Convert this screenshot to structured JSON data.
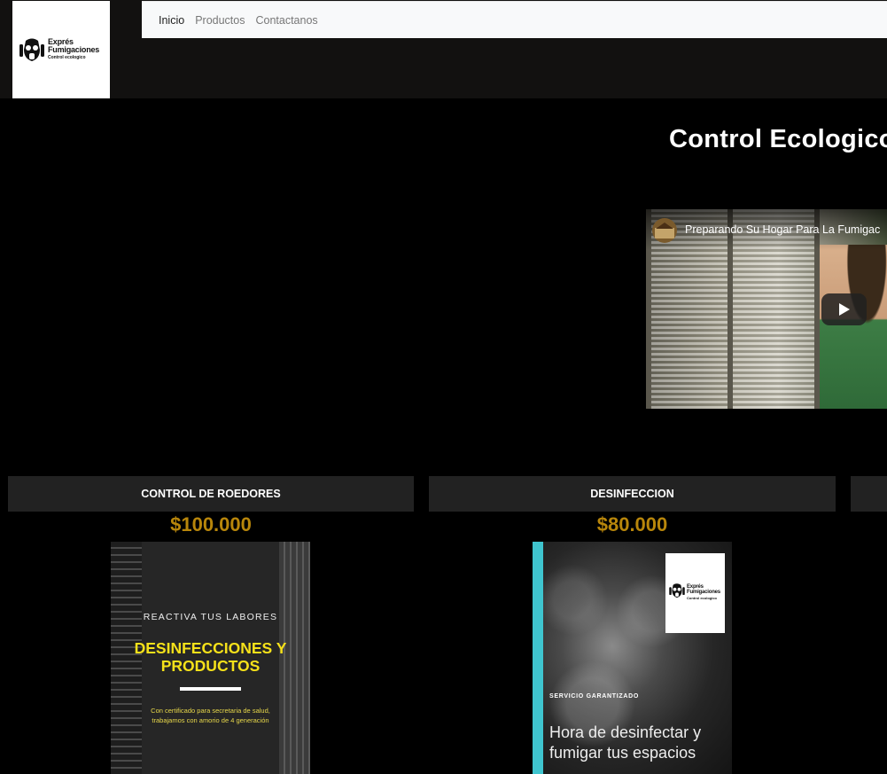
{
  "brand": {
    "name_line1": "Exprés",
    "name_line2": "Fumigaciones",
    "tagline": "Control ecologico"
  },
  "nav": {
    "items": [
      {
        "label": "Inicio",
        "active": true
      },
      {
        "label": "Productos",
        "active": false
      },
      {
        "label": "Contactanos",
        "active": false
      }
    ]
  },
  "hero": {
    "title": "Control Ecologico",
    "video": {
      "title": "Preparando Su Hogar Para La Fumigac",
      "channel_icon": "house-icon",
      "play_icon": "play-icon"
    }
  },
  "products": [
    {
      "title": "CONTROL DE ROEDORES",
      "price": "$100.000",
      "poster": {
        "kicker": "REACTIVA TUS LABORES",
        "title_line1": "DESINFECCIONES Y",
        "title_line2": "PRODUCTOS",
        "body_line1": "Con certificado para secretaria de salud,",
        "body_line2": "trabajamos con amorio de 4 generación"
      }
    },
    {
      "title": "DESINFECCION",
      "price": "$80.000",
      "poster": {
        "kicker": "SERVICIO GARANTIZADO",
        "title_line1": "Hora de desinfectar y",
        "title_line2": "fumigar tus espacios"
      }
    }
  ],
  "colors": {
    "price": "#b8860b",
    "poster_title_yellow": "#f5e11a",
    "poster_stripe": "#3fc5cf",
    "card_header_bg": "#222222"
  }
}
